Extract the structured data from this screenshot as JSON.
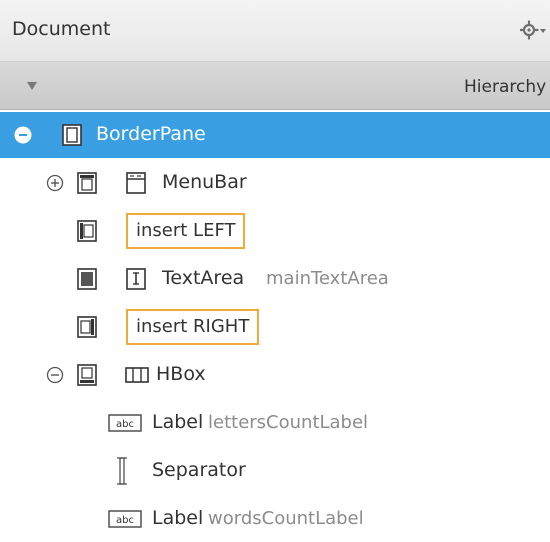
{
  "header": {
    "title": "Document",
    "gear_icon": "gear-icon"
  },
  "hierarchy": {
    "title": "Hierarchy",
    "collapse_icon": "triangle-down-icon"
  },
  "tree": {
    "border_pane": {
      "label": "BorderPane",
      "selected": true
    },
    "menu_bar": {
      "label": "MenuBar"
    },
    "insert_left": {
      "label": "insert LEFT"
    },
    "text_area": {
      "label": "TextArea",
      "id": "mainTextArea"
    },
    "insert_right": {
      "label": "insert RIGHT"
    },
    "hbox": {
      "label": "HBox"
    },
    "label1": {
      "label": "Label",
      "id": "lettersCountLabel"
    },
    "separator": {
      "label": "Separator"
    },
    "label2": {
      "label": "Label",
      "id": "wordsCountLabel"
    }
  },
  "colors": {
    "selection": "#3a9ee3",
    "insert_border": "#f2a93b"
  }
}
